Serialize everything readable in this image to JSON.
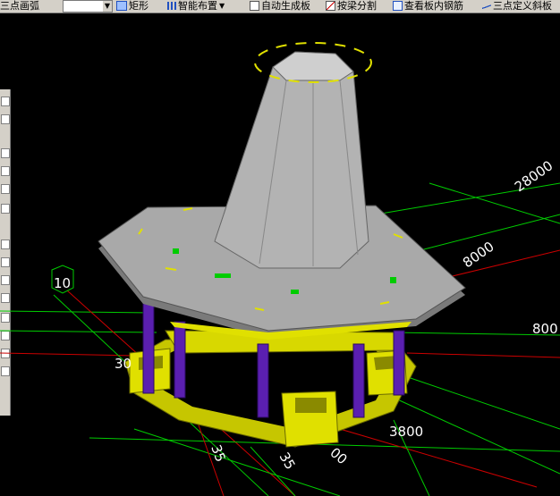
{
  "toolbar": {
    "arc_label": "三点画弧",
    "rect_label": "矩形",
    "smart_layout_label": "智能布置",
    "auto_slab_label": "自动生成板",
    "split_by_beam_label": "按梁分割",
    "view_rebar_label": "查看板内钢筋",
    "slope_slab_label": "三点定义斜板"
  },
  "viewport": {
    "axis_bubble": "10",
    "dims": [
      "28000",
      "8000",
      "800",
      "30",
      "3800",
      "35",
      "35",
      "00"
    ]
  },
  "colors": {
    "background": "#000000",
    "grid_green": "#00cc00",
    "grid_red": "#cc0000",
    "beam_yellow": "#e0e000",
    "column_purple": "#5a1fb0",
    "slab_grey": "#a9a9a9"
  }
}
